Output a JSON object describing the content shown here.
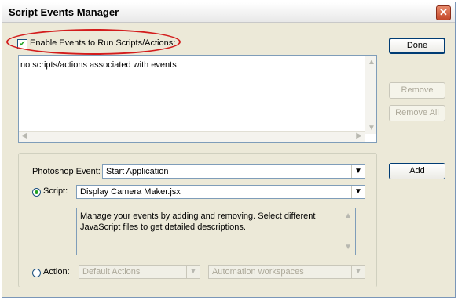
{
  "window": {
    "title": "Script Events Manager"
  },
  "enable_checkbox": {
    "label": "Enable Events to Run Scripts/Actions:",
    "checked": true
  },
  "event_list": {
    "items": [
      "no scripts/actions associated with events"
    ]
  },
  "buttons": {
    "done": "Done",
    "remove": "Remove",
    "remove_all": "Remove All",
    "add": "Add"
  },
  "form": {
    "photoshop_event_label": "Photoshop Event:",
    "photoshop_event_value": "Start Application",
    "script_label": "Script:",
    "script_value": "Display Camera Maker.jsx",
    "description": "Manage your events by adding and removing. Select different JavaScript files to get detailed descriptions.",
    "action_label": "Action:",
    "action_set_value": "Default Actions",
    "action_value": "Automation workspaces"
  },
  "colors": {
    "annotation_circle": "#d31c1c",
    "checkmark": "#21a121"
  }
}
